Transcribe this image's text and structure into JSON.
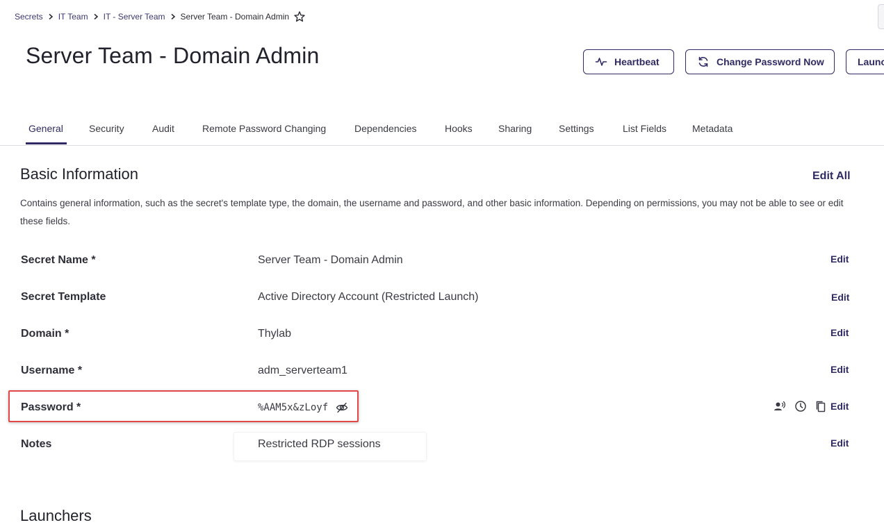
{
  "breadcrumb": {
    "items": [
      {
        "label": "Secrets"
      },
      {
        "label": "IT Team"
      },
      {
        "label": "IT - Server Team"
      }
    ],
    "current": "Server Team - Domain Admin"
  },
  "page": {
    "title": "Server Team - Domain Admin"
  },
  "actions": {
    "heartbeat": {
      "label": "Heartbeat",
      "icon": "activity-icon"
    },
    "change_password": {
      "label": "Change Password Now",
      "icon": "refresh-icon"
    },
    "launch": {
      "label": "Launc"
    }
  },
  "tabs": [
    {
      "label": "General",
      "active": true
    },
    {
      "label": "Security"
    },
    {
      "label": "Audit"
    },
    {
      "label": "Remote Password Changing"
    },
    {
      "label": "Dependencies"
    },
    {
      "label": "Hooks"
    },
    {
      "label": "Sharing"
    },
    {
      "label": "Settings"
    },
    {
      "label": "List Fields"
    },
    {
      "label": "Metadata"
    }
  ],
  "basic_info": {
    "title": "Basic Information",
    "edit_all": "Edit All",
    "description": "Contains general information, such as the secret's template type, the domain, the username and password, and other basic information. Depending on permissions, you may not be able to see or edit these fields.",
    "fields": [
      {
        "label": "Secret Name *",
        "value": "Server Team - Domain Admin",
        "edit": "Edit"
      },
      {
        "label": "Secret Template",
        "value": "Active Directory Account (Restricted Launch)",
        "edit": "Edit"
      },
      {
        "label": "Domain *",
        "value": "Thylab",
        "edit": "Edit"
      },
      {
        "label": "Username *",
        "value": "adm_serverteam1",
        "edit": "Edit"
      },
      {
        "label": "Password *",
        "value": "%AAM5x&zLoyf",
        "edit": "Edit",
        "icons": [
          "speak-password-icon",
          "clock-icon",
          "copy-icon",
          "eye-off-icon"
        ]
      },
      {
        "label": "Notes",
        "value": "Restricted RDP sessions",
        "edit": "Edit"
      }
    ]
  },
  "launchers": {
    "title": "Launchers"
  },
  "colors": {
    "brand": "#2f2a63",
    "highlight": "#e04848"
  }
}
